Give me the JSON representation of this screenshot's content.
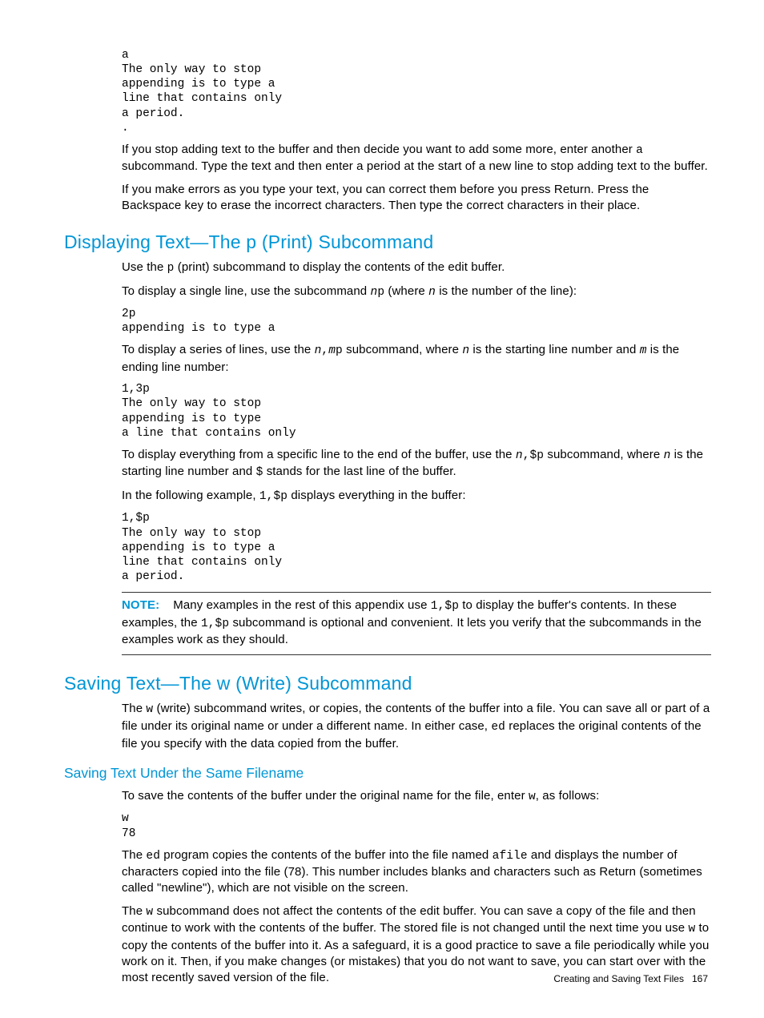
{
  "intro": {
    "code1": "a\nThe only way to stop\nappending is to type a\nline that contains only\na period.\n.",
    "p1_pre": "If you stop adding text to the buffer and then decide you want to add some more, enter another ",
    "p1_code": "a",
    "p1_post": " subcommand. Type the text and then enter a period at the start of a new line to stop adding text to the buffer.",
    "p2": "If you make errors as you type your text, you can correct them before you press Return. Press the Backspace key to erase the incorrect characters. Then type the correct characters in their place."
  },
  "display": {
    "heading": "Displaying Text—The p (Print) Subcommand",
    "p1_pre": "Use the ",
    "p1_code": "p",
    "p1_post": " (print) subcommand to display the contents of the edit buffer.",
    "p2_pre": "To display a single line, use the subcommand ",
    "p2_n": "n",
    "p2_p": "p",
    "p2_mid": " (where ",
    "p2_n2": "n",
    "p2_post": " is the number of the line):",
    "code1": "2p\nappending is to type a",
    "p3_pre": "To display a series of lines, use the ",
    "p3_n": "n",
    "p3_comma": ",",
    "p3_m": "m",
    "p3_p": "p",
    "p3_mid": " subcommand, where ",
    "p3_n2": "n",
    "p3_mid2": " is the starting line number and ",
    "p3_m2": "m",
    "p3_post": " is the ending line number:",
    "code2": "1,3p\nThe only way to stop\nappending is to type\na line that contains only",
    "p4_pre": "To display everything from a specific line to the end of the buffer, use the  ",
    "p4_n": "n",
    "p4_cmd": ",$p",
    "p4_mid": " subcommand, where ",
    "p4_n2": "n",
    "p4_mid2": " is the starting line number and ",
    "p4_dollar": "$",
    "p4_post": " stands for the last line of the buffer.",
    "p5_pre": "In the following example, ",
    "p5_cmd": "1,$p",
    "p5_post": " displays everything in the buffer:",
    "code3": "1,$p\nThe only way to stop\nappending is to type a\nline that contains only\na period.",
    "note_label": "NOTE:",
    "note_pre": "Many examples in the rest of this appendix use ",
    "note_cmd1": "1,$p",
    "note_mid": " to display the buffer's contents. In these examples, the ",
    "note_cmd2": "1,$p",
    "note_post": " subcommand is optional and convenient. It lets you verify that the subcommands in the examples work as they should."
  },
  "saving": {
    "heading": "Saving Text—The w (Write) Subcommand",
    "p1_pre": "The ",
    "p1_w": "w",
    "p1_mid": " (write) subcommand writes, or copies, the contents of the buffer into a file. You can save all or part of a file under its original name or under a different name. In either case, ",
    "p1_ed": "ed",
    "p1_post": " replaces the original contents of the file you specify with the data copied from the buffer.",
    "sub_heading": "Saving Text Under the Same Filename",
    "p2_pre": "To save the contents of the buffer under the original name for the file, enter ",
    "p2_w": "w",
    "p2_post": ", as follows:",
    "code1": "w\n78",
    "p3_pre": "The ",
    "p3_ed": "ed",
    "p3_mid": " program copies the contents of the buffer into the file named ",
    "p3_file": "afile",
    "p3_post": " and displays the number of characters copied into the file (78). This number includes blanks and characters such as Return (sometimes called \"newline\"), which are not visible on the screen.",
    "p4_pre": "The ",
    "p4_w": "w",
    "p4_mid": " subcommand does not affect the contents of the edit buffer. You can save a copy of the file and then continue to work with the contents of the buffer. The stored file is not changed until the next time you use ",
    "p4_w2": "w",
    "p4_post": " to copy the contents of the buffer into it. As a safeguard, it is a good practice to save a file periodically while you work on it. Then, if you make changes (or mistakes) that you do not want to save, you can start over with the most recently saved version of the file."
  },
  "footer": {
    "text": "Creating and Saving Text Files",
    "page": "167"
  }
}
